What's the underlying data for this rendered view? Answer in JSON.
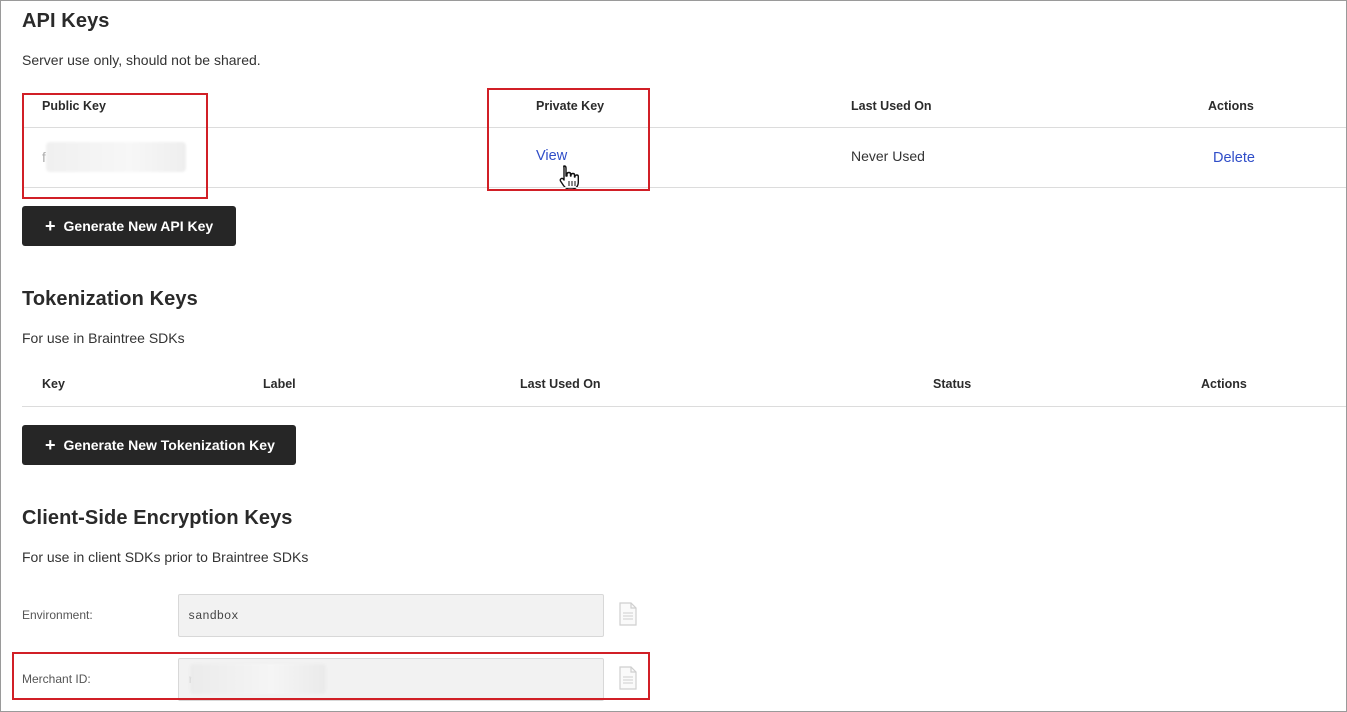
{
  "api_keys": {
    "title": "API Keys",
    "subtitle": "Server use only, should not be shared.",
    "columns": [
      "Public Key",
      "Private Key",
      "Last Used On",
      "Actions"
    ],
    "row": {
      "public_key_prefix": "f",
      "private_key_action": "View",
      "last_used": "Never Used",
      "action": "Delete"
    },
    "generate_button": "Generate New API Key"
  },
  "tokenization_keys": {
    "title": "Tokenization Keys",
    "subtitle": "For use in Braintree SDKs",
    "columns": [
      "Key",
      "Label",
      "Last Used On",
      "Status",
      "Actions"
    ],
    "generate_button": "Generate New Tokenization Key"
  },
  "cse_keys": {
    "title": "Client-Side Encryption Keys",
    "subtitle": "For use in client SDKs prior to Braintree SDKs",
    "environment_label": "Environment:",
    "environment_value": "sandbox",
    "merchant_id_label": "Merchant ID:",
    "merchant_id_prefix": "r"
  },
  "icons": {
    "plus": "plus-icon",
    "copy": "copy-icon",
    "cursor": "hand-pointer-icon"
  },
  "colors": {
    "link": "#2f4dc8",
    "button_bg": "#262626",
    "highlight": "#d11f26"
  }
}
